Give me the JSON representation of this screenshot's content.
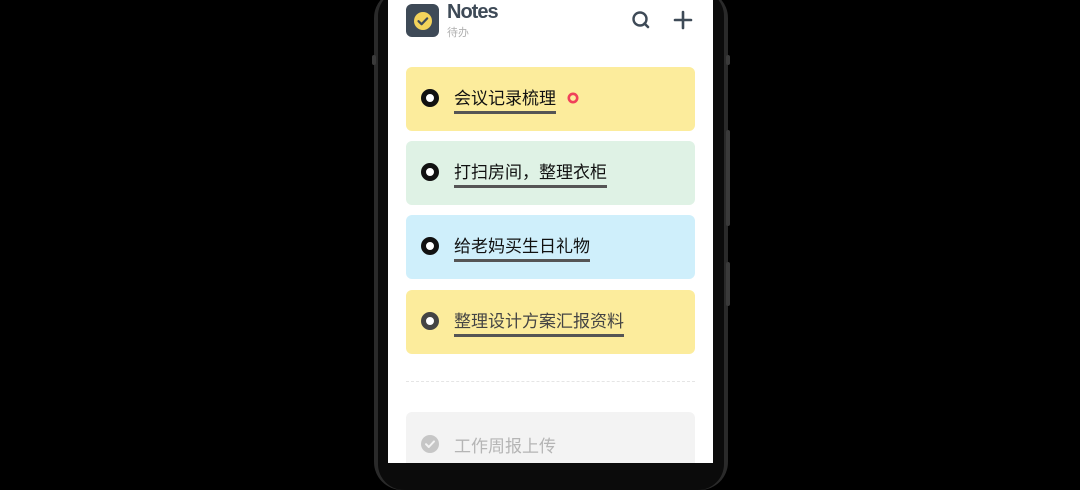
{
  "header": {
    "title": "Notes",
    "subtitle": "待办",
    "logo_icon": "check-circle-icon",
    "search_icon": "search-icon",
    "add_icon": "plus-icon",
    "logo_color": "#3e4a57",
    "logo_accent": "#f3d35b"
  },
  "todos": [
    {
      "text": "会议记录梳理",
      "color": "#fcec9c",
      "status": "active",
      "flag": "red-dot"
    },
    {
      "text": "打扫房间，整理衣柜",
      "color": "#dff2e5",
      "status": "active"
    },
    {
      "text": "给老妈买生日礼物",
      "color": "#cfeffb",
      "status": "active"
    },
    {
      "text": "整理设计方案汇报资料",
      "color": "#fcec9c",
      "status": "active",
      "muted": true
    }
  ],
  "completed": [
    {
      "text": "工作周报上传",
      "color": "#f3f3f3",
      "status": "done"
    }
  ],
  "colors": {
    "background": "#000000",
    "screen": "#ffffff",
    "flag": "#f0415a"
  }
}
